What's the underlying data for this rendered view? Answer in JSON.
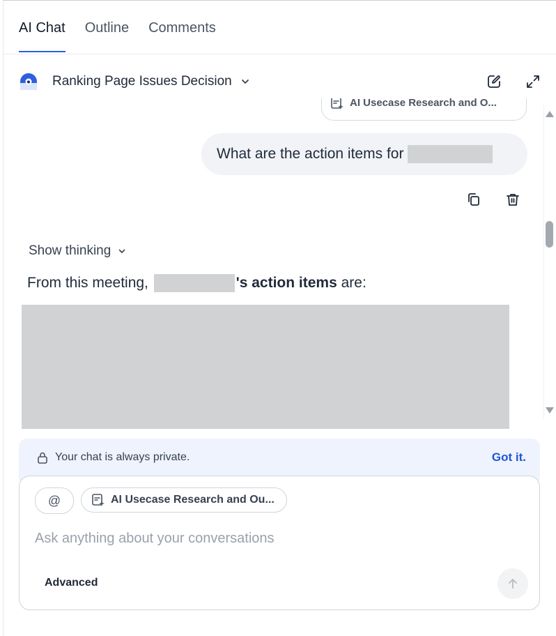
{
  "tabs": [
    {
      "label": "AI Chat",
      "active": true
    },
    {
      "label": "Outline",
      "active": false
    },
    {
      "label": "Comments",
      "active": false
    }
  ],
  "header": {
    "title": "Ranking Page Issues Decision",
    "icons": [
      "avatar-icon",
      "chevron-down-icon",
      "edit-icon",
      "expand-icon"
    ]
  },
  "chat": {
    "context_chip_top": "AI Usecase Research and O...",
    "user_message": "What are the action items for",
    "show_thinking": "Show thinking",
    "answer_prefix": "From this meeting,",
    "answer_bold": "'s action items",
    "answer_suffix": "are:"
  },
  "privacy": {
    "text": "Your chat is always private.",
    "action": "Got it."
  },
  "composer": {
    "at_label": "@",
    "context_chip": "AI Usecase Research and Ou...",
    "placeholder": "Ask anything about your conversations",
    "advanced_label": "Advanced"
  },
  "colors": {
    "accent": "#2b5ce6",
    "link": "#2155d6",
    "privacy_bg": "#eef3fd",
    "redacted": "#d1d2d4"
  }
}
